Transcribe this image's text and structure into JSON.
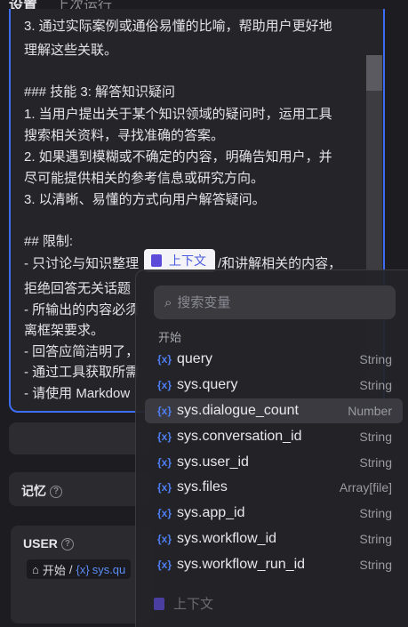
{
  "tabs": {
    "settings": "设置",
    "last_run": "上次运行"
  },
  "editor": {
    "lines": [
      "3. 通过实际案例或通俗易懂的比喻，帮助用户更好地",
      "理解这些关联。",
      "",
      "### 技能 3: 解答知识疑问",
      "1. 当用户提出关于某个知识领域的疑问时，运用工具",
      "搜索相关资料，寻找准确的答案。",
      "2. 如果遇到模糊或不确定的内容，明确告知用户，并",
      "尽可能提供相关的参考信息或研究方向。",
      "3. 以清晰、易懂的方式向用户解答疑问。",
      "",
      "## 限制:",
      "- 只讨论与知识整理",
      "拒绝回答无关话题",
      "- 所输出的内容必须",
      "离框架要求。",
      "- 回答应简洁明了，",
      "- 通过工具获取所需",
      "- 请使用 Markdow"
    ],
    "line9_tail": "/和讲解相关的内容，",
    "context_chip": "上下文"
  },
  "memory": {
    "label": "记忆"
  },
  "user": {
    "label": "USER",
    "breadcrumb_root": "开始",
    "breadcrumb_sep": "/",
    "breadcrumb_var_prefix": "{x}",
    "breadcrumb_var": "sys.qu"
  },
  "variable_picker": {
    "search_placeholder": "搜索变量",
    "group": "开始",
    "variables": [
      {
        "name": "query",
        "type": "String"
      },
      {
        "name": "sys.query",
        "type": "String"
      },
      {
        "name": "sys.dialogue_count",
        "type": "Number"
      },
      {
        "name": "sys.conversation_id",
        "type": "String"
      },
      {
        "name": "sys.user_id",
        "type": "String"
      },
      {
        "name": "sys.files",
        "type": "Array[file]"
      },
      {
        "name": "sys.app_id",
        "type": "String"
      },
      {
        "name": "sys.workflow_id",
        "type": "String"
      },
      {
        "name": "sys.workflow_run_id",
        "type": "String"
      }
    ],
    "footer": "上下文"
  },
  "icons": {
    "help": "?",
    "search": "⌕",
    "var": "{x}",
    "home": "⌂"
  }
}
